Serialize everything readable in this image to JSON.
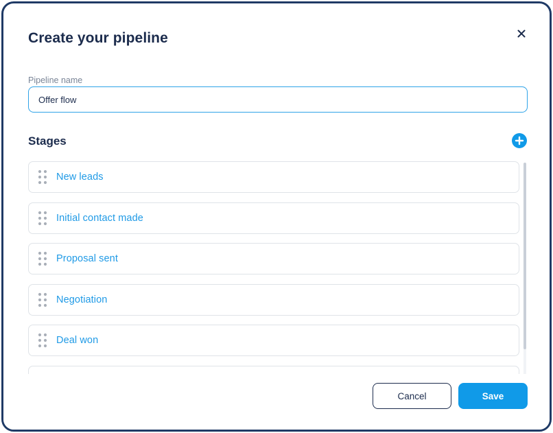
{
  "dialog": {
    "title": "Create your pipeline",
    "close_icon": "close-icon"
  },
  "pipeline_name": {
    "label": "Pipeline name",
    "value": "Offer flow"
  },
  "stages": {
    "title": "Stages",
    "add_icon": "plus-circle-icon",
    "items": [
      {
        "label": "New leads"
      },
      {
        "label": "Initial contact made"
      },
      {
        "label": "Proposal sent"
      },
      {
        "label": "Negotiation"
      },
      {
        "label": "Deal won"
      },
      {
        "label": ""
      }
    ]
  },
  "footer": {
    "cancel_label": "Cancel",
    "save_label": "Save"
  },
  "colors": {
    "accent": "#109ae8",
    "title_text": "#1b2b4c",
    "stage_text": "#1f9ae6",
    "frame": "#1f3a66"
  }
}
